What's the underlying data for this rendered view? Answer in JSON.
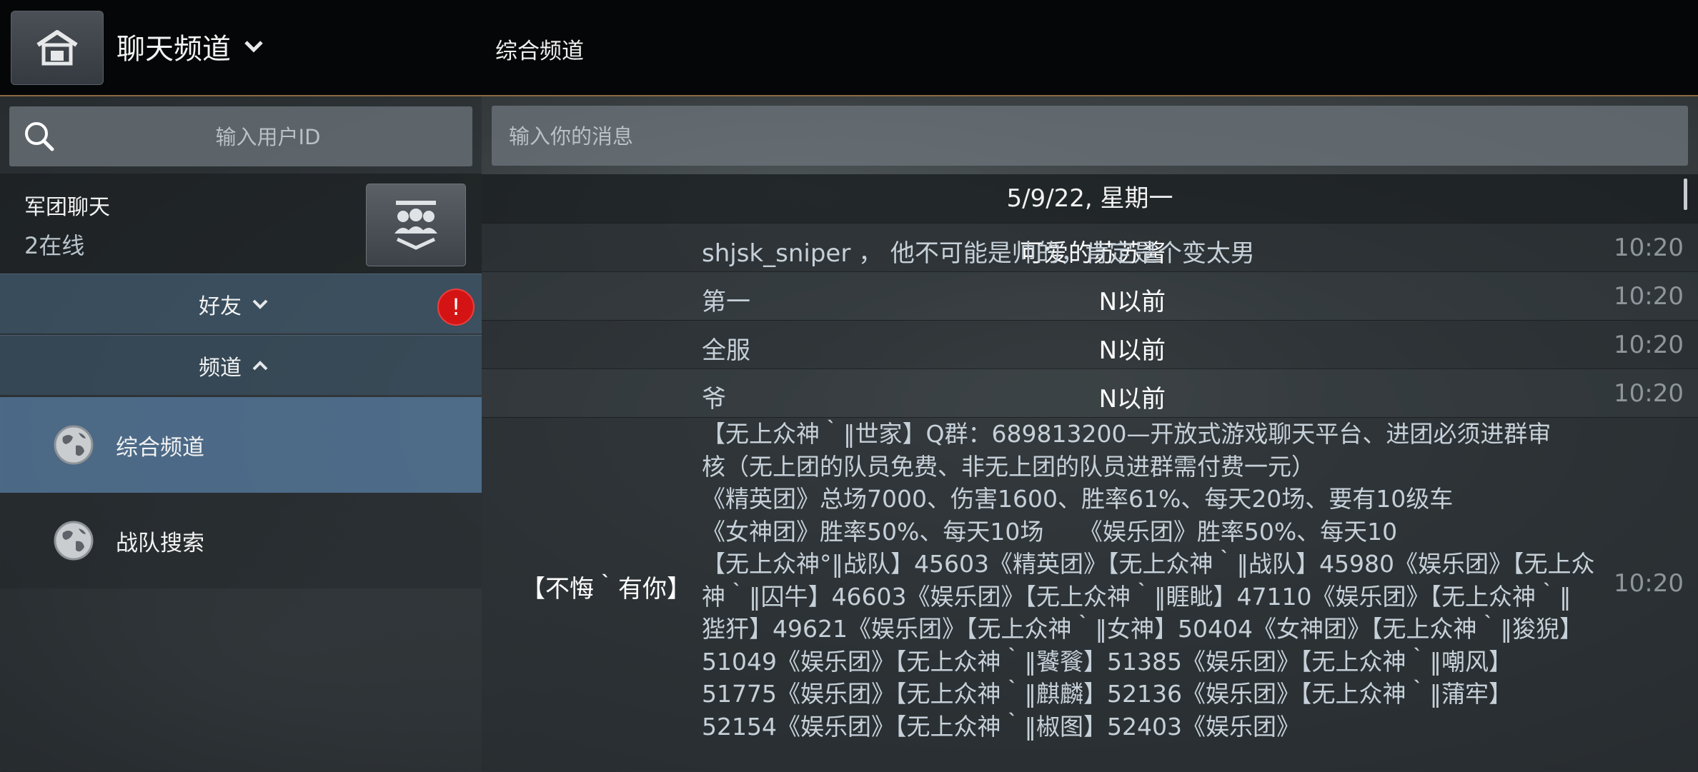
{
  "header": {
    "title": "聊天频道",
    "channel_title": "综合频道"
  },
  "search": {
    "placeholder": "输入用户ID"
  },
  "message_input": {
    "placeholder": "输入你的消息"
  },
  "legion": {
    "name": "军团聊天",
    "online": "2在线"
  },
  "sections": {
    "friends": "好友",
    "friends_alert": "!",
    "channels": "频道"
  },
  "channels": [
    {
      "label": "综合频道",
      "selected": true
    },
    {
      "label": "战队搜索",
      "selected": false
    }
  ],
  "chat": {
    "date": "5/9/22, 星期一",
    "messages": [
      {
        "sender": "可爱的苏苏酱",
        "text": "shjsk_sniper ， 他不可能是帅的，肯定是个变太男",
        "time": "10:20"
      },
      {
        "sender": "N以前",
        "text": "第一",
        "time": "10:20"
      },
      {
        "sender": "N以前",
        "text": "全服",
        "time": "10:20"
      },
      {
        "sender": "N以前",
        "text": "爷",
        "time": "10:20"
      }
    ],
    "long_message": {
      "sender": "【不悔｀有你】",
      "time": "10:20",
      "lines": [
        "【无上众神｀‖世家】Q群：689813200—开放式游戏聊天平台、进团必须进群审",
        "核（无上团的队员免费、非无上团的队员进群需付费一元）",
        "《精英团》总场7000、伤害1600、胜率61%、每天20场、要有10级车",
        "《女神团》胜率50%、每天10场　　《娱乐团》胜率50%、每天10",
        "【无上众神°‖战队】45603《精英团》【无上众神｀‖战队】45980《娱乐团》【无上众",
        "神｀‖囚牛】46603《娱乐团》【无上众神｀‖睚眦】47110《娱乐团》【无上众神｀‖",
        "狴犴】49621《娱乐团》【无上众神｀‖女神】50404《女神团》【无上众神｀‖狻猊】",
        "51049《娱乐团》【无上众神｀‖饕餮】51385《娱乐团》【无上众神｀‖嘲风】",
        "51775《娱乐团》【无上众神｀‖麒麟】52136《娱乐团》【无上众神｀‖蒲牢】",
        "52154《娱乐团》【无上众神｀‖椒图】52403《娱乐团》"
      ]
    }
  },
  "colors": {
    "accent_line": "#8a6a42",
    "selected_channel": "#5a82aa",
    "alert": "#d41414"
  }
}
